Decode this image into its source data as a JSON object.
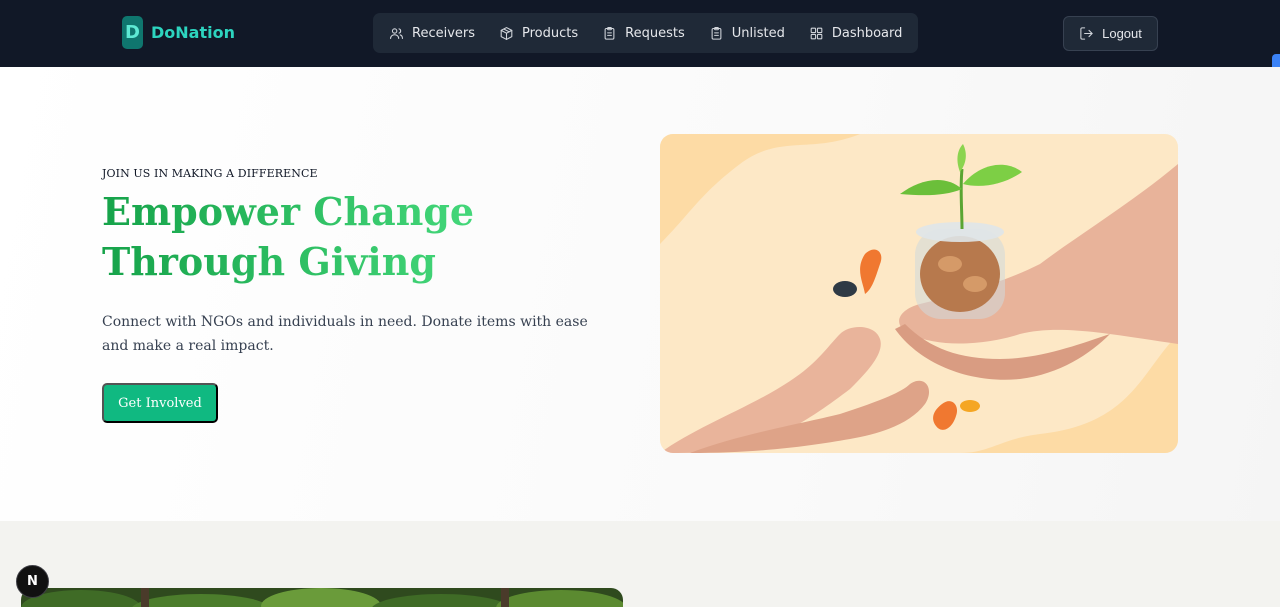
{
  "brand": {
    "logo_letter": "D",
    "name": "DoNation"
  },
  "nav": {
    "items": [
      {
        "label": "Receivers",
        "icon": "users-icon"
      },
      {
        "label": "Products",
        "icon": "package-icon"
      },
      {
        "label": "Requests",
        "icon": "clipboard-icon"
      },
      {
        "label": "Unlisted",
        "icon": "clipboard-icon"
      },
      {
        "label": "Dashboard",
        "icon": "grid-icon"
      }
    ],
    "logout_label": "Logout"
  },
  "hero": {
    "eyebrow": "JOIN US IN MAKING A DIFFERENCE",
    "headline_line1": "Empower Change",
    "headline_line2": "Through Giving",
    "subtext": "Connect with NGOs and individuals in need. Donate items with ease and make a real impact.",
    "cta_label": "Get Involved"
  },
  "dev_badge": {
    "letter": "N"
  },
  "colors": {
    "navbar_bg": "#111827",
    "brand_accent": "#2dd4bf",
    "headline_green": "#22a559",
    "cta_green": "#10b981",
    "hero_image_bg": "#fde8c6"
  }
}
